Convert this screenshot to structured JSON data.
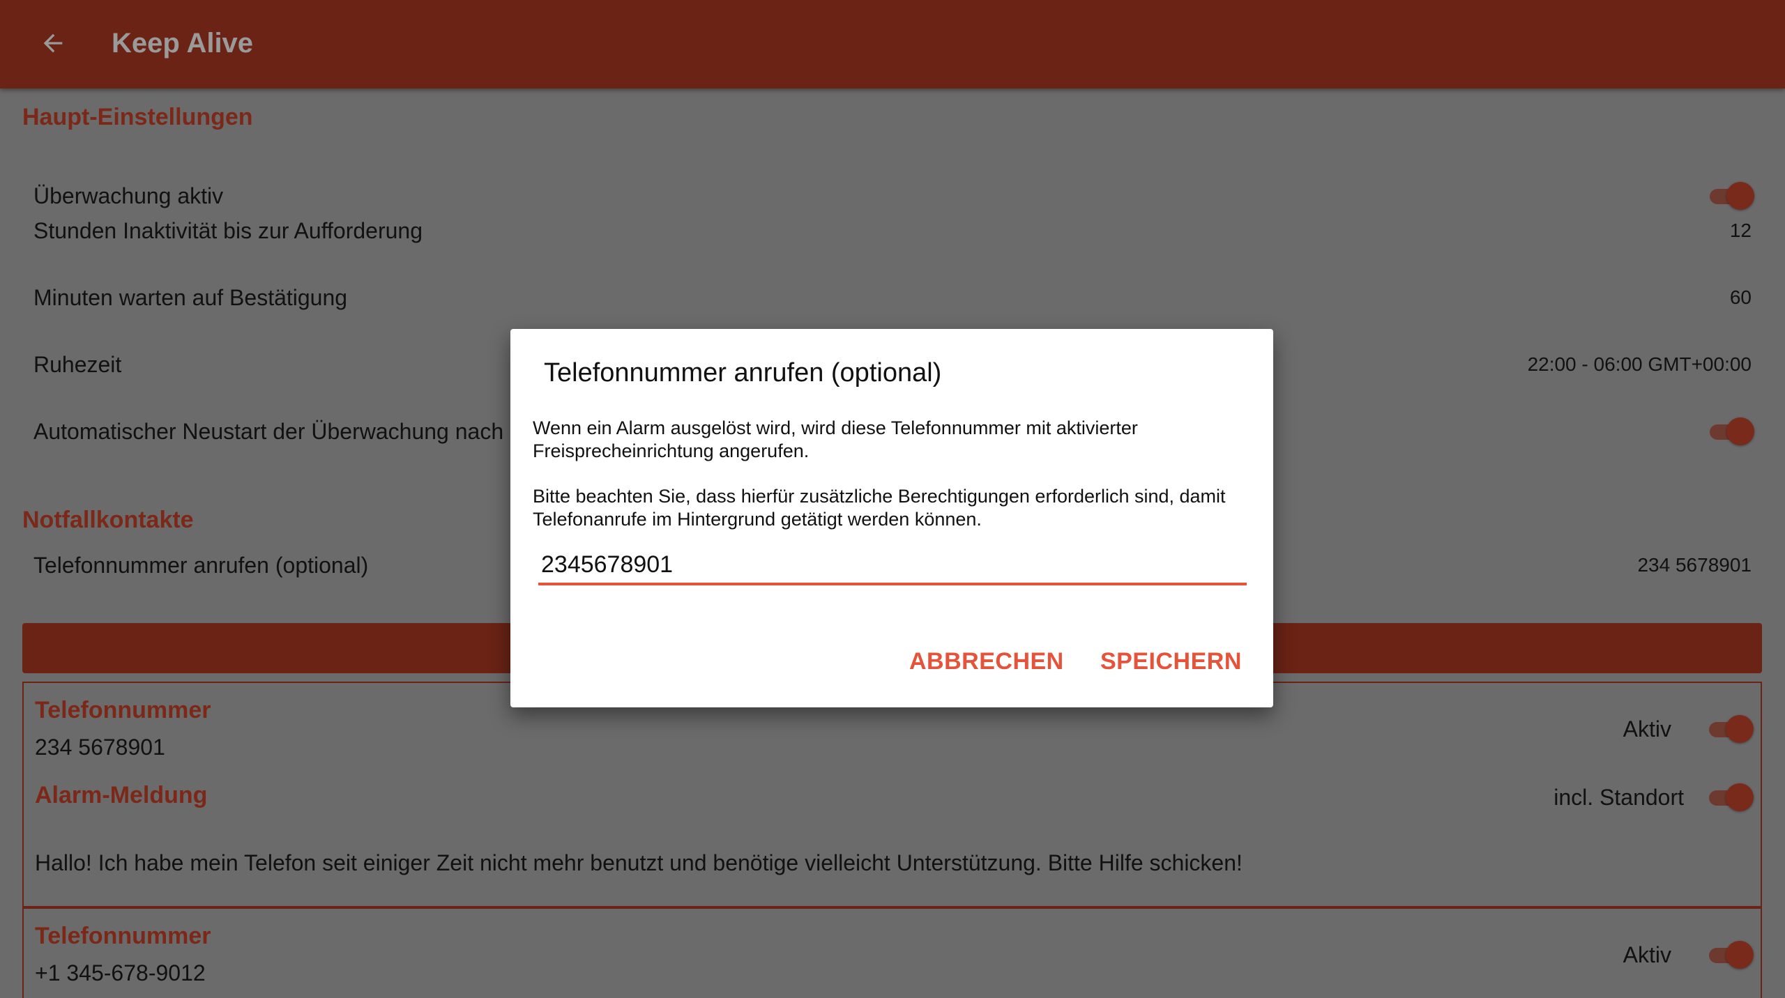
{
  "appbar": {
    "title": "Keep Alive",
    "back_icon": "arrow-back-icon"
  },
  "main_settings": {
    "header": "Haupt-Einstellungen",
    "monitoring_label": "Überwachung aktiv",
    "hours_label": "Stunden Inaktivität bis zur Aufforderung",
    "hours_value": "12",
    "minutes_label": "Minuten warten auf Bestätigung",
    "minutes_value": "60",
    "quiet_label": "Ruhezeit",
    "quiet_value": "22:00 - 06:00 GMT+00:00",
    "restart_label": "Automatischer Neustart der Überwachung nach"
  },
  "contacts": {
    "header": "Notfallkontakte",
    "call_label": "Telefonnummer anrufen (optional)",
    "call_value": "234 5678901",
    "cards": [
      {
        "phone_title": "Telefonnummer",
        "phone": "234 5678901",
        "active_label": "Aktiv",
        "message_title": "Alarm-Meldung",
        "location_label": "incl. Standort",
        "message": "Hallo! Ich habe mein Telefon seit einiger Zeit nicht mehr benutzt und benötige vielleicht Unterstützung. Bitte Hilfe schicken!"
      },
      {
        "phone_title": "Telefonnummer",
        "phone": "+1 345-678-9012",
        "active_label": "Aktiv"
      }
    ]
  },
  "dialog": {
    "title": "Telefonnummer anrufen (optional)",
    "message1": "Wenn ein Alarm ausgelöst wird, wird diese Telefonnummer mit aktivierter Freisprecheinrichtung angerufen.",
    "message2": "Bitte beachten Sie, dass hierfür zusätzliche Berechtigungen erforderlich sind, damit Telefonanrufe im Hintergrund getätigt werden können.",
    "input_value": "2345678901",
    "cancel_label": "ABBRECHEN",
    "save_label": "SPEICHERN"
  },
  "colors": {
    "primary_dark": "#6a2315",
    "accent": "#e5533a",
    "scrim_background": "#6b6b6b"
  }
}
